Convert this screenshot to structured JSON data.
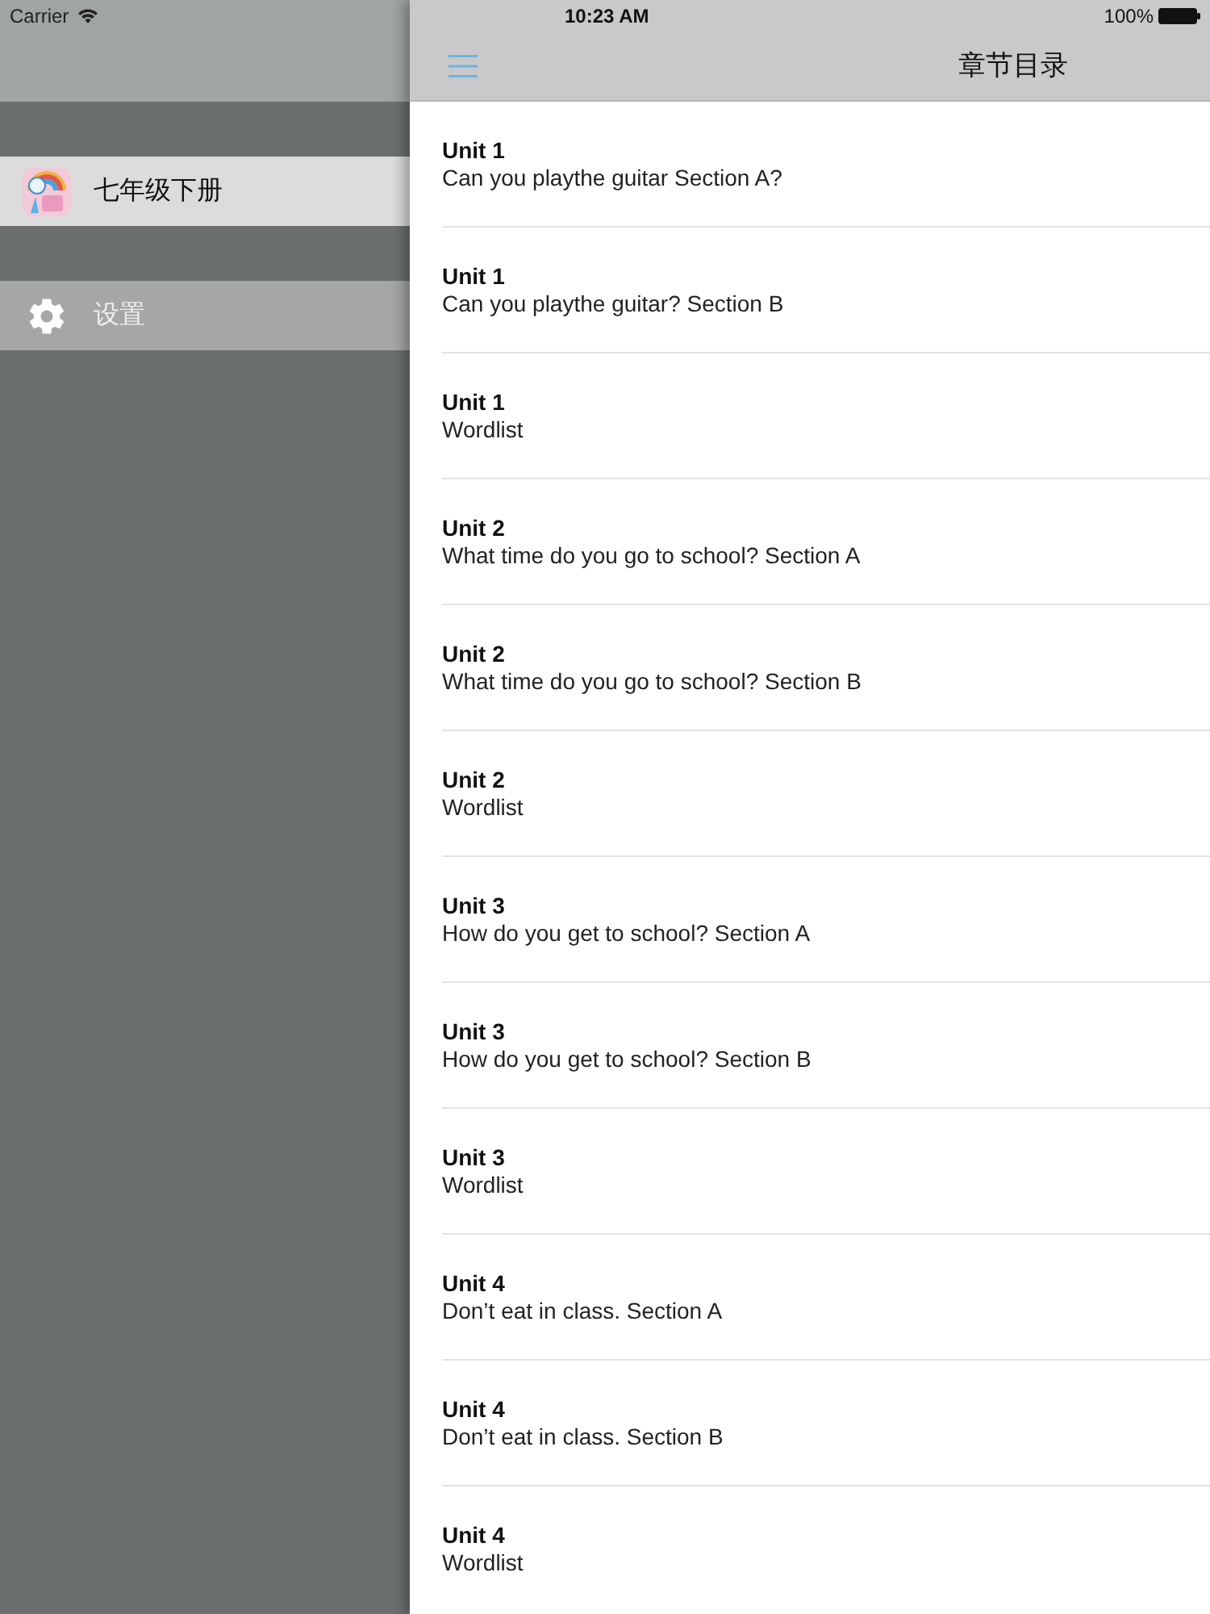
{
  "status_bar": {
    "carrier": "Carrier",
    "time": "10:23 AM",
    "battery": "100%"
  },
  "sidebar": {
    "items": [
      {
        "kind": "book",
        "label": "七年级下册",
        "selected": true
      },
      {
        "kind": "settings",
        "label": "设置",
        "selected": false
      }
    ]
  },
  "nav_bar": {
    "title": "章节目录"
  },
  "chapters": [
    {
      "unit": "Unit 1",
      "title": "Can you playthe guitar Section A?"
    },
    {
      "unit": "Unit 1",
      "title": "Can you playthe guitar? Section B"
    },
    {
      "unit": "Unit 1",
      "title": "Wordlist"
    },
    {
      "unit": "Unit 2",
      "title": "What time do you go to school? Section A"
    },
    {
      "unit": "Unit 2",
      "title": "What time do you go to school? Section B"
    },
    {
      "unit": "Unit 2",
      "title": "Wordlist"
    },
    {
      "unit": "Unit 3",
      "title": "How do you get to school? Section A"
    },
    {
      "unit": "Unit 3",
      "title": "How do you get to school? Section B"
    },
    {
      "unit": "Unit 3",
      "title": "Wordlist"
    },
    {
      "unit": "Unit 4",
      "title": "Don’t eat in class. Section A"
    },
    {
      "unit": "Unit 4",
      "title": "Don’t eat in class. Section B"
    },
    {
      "unit": "Unit 4",
      "title": "Wordlist"
    }
  ]
}
